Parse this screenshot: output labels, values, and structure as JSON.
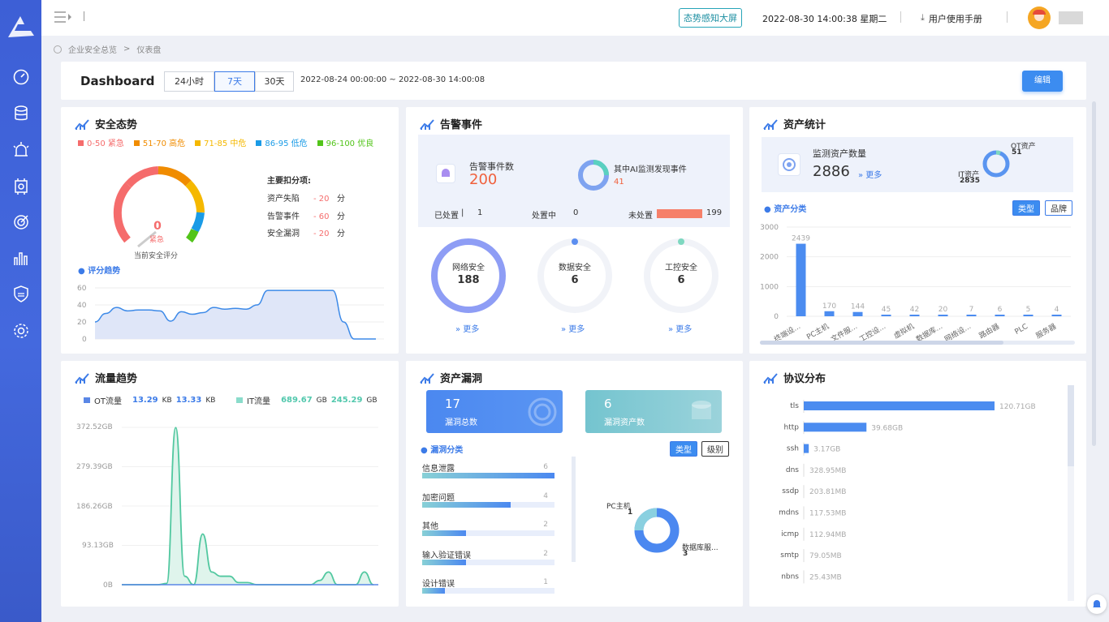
{
  "sidebar": {
    "nav": [
      "dashboard-icon",
      "database-icon",
      "alarm-icon",
      "chip-icon",
      "target-icon",
      "chart-icon",
      "shield-icon",
      "gear-icon"
    ]
  },
  "topbar": {
    "big_screen": "态势感知大屏",
    "datetime": "2022-08-30 14:00:38 星期二",
    "manual": "用户使用手册"
  },
  "breadcrumb": {
    "home": "企业安全总览",
    "sep": ">",
    "current": "仪表盘"
  },
  "dashboard": {
    "title": "Dashboard",
    "tabs": [
      "24小时",
      "7天",
      "30天"
    ],
    "active_tab": "7天",
    "range": "2022-08-24 00:00:00 ~ 2022-08-30 14:00:08",
    "edit": "编辑"
  },
  "security": {
    "title": "安全态势",
    "legend": [
      {
        "label": "0-50 紧急",
        "color": "#f56c6c"
      },
      {
        "label": "51-70 高危",
        "color": "#f08c00"
      },
      {
        "label": "71-85 中危",
        "color": "#f5b800"
      },
      {
        "label": "86-95 低危",
        "color": "#1a9be6"
      },
      {
        "label": "96-100 优良",
        "color": "#52c41a"
      }
    ],
    "score": "0",
    "level": "紧急",
    "score_label": "当前安全评分",
    "deduct_title": "主要扣分项:",
    "deductions": [
      {
        "name": "资产失陷",
        "value": "- 20",
        "unit": "分"
      },
      {
        "name": "告警事件",
        "value": "- 60",
        "unit": "分"
      },
      {
        "name": "安全漏洞",
        "value": "- 20",
        "unit": "分"
      }
    ],
    "trend_label": "评分趋势",
    "trend_y": [
      "60",
      "40",
      "20",
      "0"
    ]
  },
  "alerts": {
    "title": "告警事件",
    "count_label": "告警事件数",
    "count": "200",
    "ai_label": "其中AI监测发现事件",
    "ai_count": "41",
    "handled_label": "已处置",
    "handled": "1",
    "processing_label": "处置中",
    "processing": "0",
    "unhandled_label": "未处置",
    "unhandled": "199",
    "rings": [
      {
        "name": "网络安全",
        "value": "188",
        "more": "更多"
      },
      {
        "name": "数据安全",
        "value": "6",
        "more": "更多"
      },
      {
        "name": "工控安全",
        "value": "6",
        "more": "更多"
      }
    ]
  },
  "assets": {
    "title": "资产统计",
    "monitor_label": "监测资产数量",
    "monitor_count": "2886",
    "more": "更多",
    "ot_label": "OT资产",
    "ot_count": "51",
    "it_label": "IT资产",
    "it_count": "2835",
    "category_label": "资产分类",
    "btn_type": "类型",
    "btn_brand": "品牌"
  },
  "traffic": {
    "title": "流量趋势",
    "ot_label": "OT流量",
    "ot_v1": "13.29",
    "ot_u1": "KB",
    "ot_v2": "13.33",
    "ot_u2": "KB",
    "it_label": "IT流量",
    "it_v1": "689.67",
    "it_u1": "GB",
    "it_v2": "245.29",
    "it_u2": "GB",
    "y": [
      "372.52GB",
      "279.39GB",
      "186.26GB",
      "93.13GB",
      "0B"
    ]
  },
  "vuln": {
    "title": "资产漏洞",
    "total": "17",
    "total_label": "漏洞总数",
    "assets": "6",
    "assets_label": "漏洞资产数",
    "category_label": "漏洞分类",
    "btn_type": "类型",
    "btn_level": "级别",
    "items": [
      {
        "name": "信息泄露",
        "value": "6",
        "pct": 1
      },
      {
        "name": "加密问题",
        "value": "4",
        "pct": 0.67
      },
      {
        "name": "其他",
        "value": "2",
        "pct": 0.33
      },
      {
        "name": "输入验证错误",
        "value": "2",
        "pct": 0.33
      },
      {
        "name": "设计错误",
        "value": "1",
        "pct": 0.17
      }
    ],
    "pie_pc_label": "PC主机",
    "pie_pc": "1",
    "pie_db_label": "数据库服...",
    "pie_db": "3"
  },
  "protocol": {
    "title": "协议分布"
  },
  "chart_data": [
    {
      "type": "bar",
      "title": "资产分类",
      "categories": [
        "终端设...",
        "PC主机",
        "文件服...",
        "工控设...",
        "虚拟机",
        "数据库...",
        "网络设...",
        "路由器",
        "PLC",
        "服务器"
      ],
      "values": [
        2439,
        170,
        144,
        45,
        42,
        20,
        7,
        6,
        5,
        4
      ],
      "ylim": [
        0,
        3000
      ],
      "yticks": [
        0,
        1000,
        2000,
        3000
      ]
    },
    {
      "type": "bar",
      "title": "协议分布",
      "categories": [
        "tls",
        "http",
        "ssh",
        "dns",
        "ssdp",
        "mdns",
        "icmp",
        "smtp",
        "nbns"
      ],
      "values": [
        120.71,
        39.68,
        3.17,
        0.329,
        0.204,
        0.118,
        0.113,
        0.079,
        0.025
      ],
      "labels": [
        "120.71GB",
        "39.68GB",
        "3.17GB",
        "328.95MB",
        "203.81MB",
        "117.53MB",
        "112.94MB",
        "79.05MB",
        "25.43MB"
      ],
      "unit": "GB"
    },
    {
      "type": "area",
      "title": "评分趋势",
      "values": [
        20,
        30,
        37,
        33,
        34,
        34,
        33,
        21,
        32,
        29,
        31,
        37,
        35,
        36,
        35,
        40,
        57,
        57,
        57,
        57,
        57,
        57,
        57,
        20,
        0,
        0,
        0
      ],
      "ylim": [
        0,
        60
      ]
    },
    {
      "type": "area",
      "title": "流量趋势",
      "values": [
        0,
        0,
        0,
        0,
        0,
        3,
        372,
        20,
        0,
        120,
        30,
        20,
        20,
        5,
        5,
        0,
        0,
        0,
        0,
        0,
        0,
        0,
        10,
        30,
        0,
        0,
        0,
        30,
        0
      ],
      "ylim": [
        0,
        372.52
      ]
    }
  ]
}
